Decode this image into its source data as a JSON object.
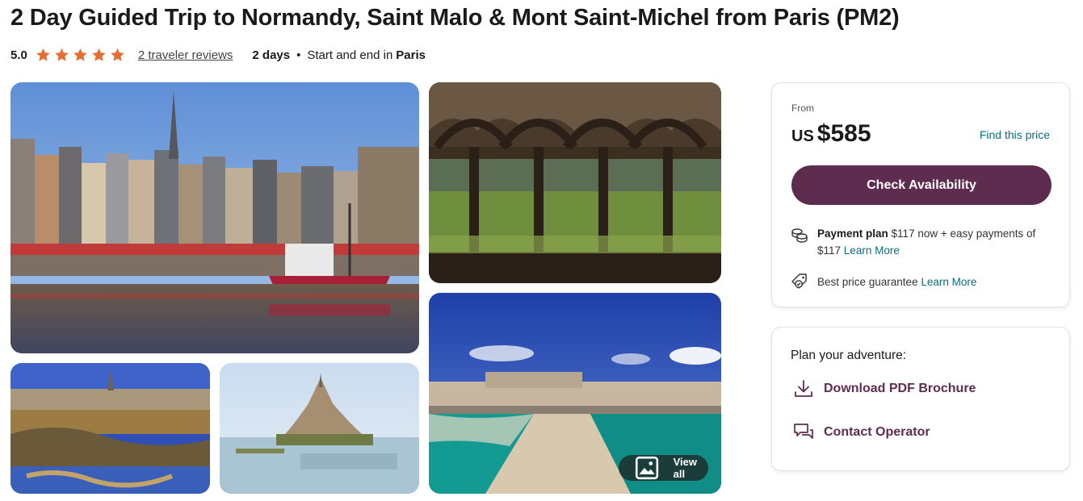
{
  "title": "2 Day Guided Trip to Normandy, Saint Malo & Mont Saint-Michel from Paris (PM2)",
  "meta": {
    "rating": "5.0",
    "stars": 5,
    "reviews_link": "2 traveler reviews",
    "duration": "2 days",
    "separator": "•",
    "start_end_prefix": "Start and end in",
    "city": "Paris"
  },
  "gallery": {
    "view_all_label": "View all"
  },
  "price_card": {
    "from_label": "From",
    "currency": "US",
    "amount": "$585",
    "find_price_link": "Find this price",
    "check_availability_label": "Check Availability",
    "payment_plan_label": "Payment plan",
    "payment_plan_text": "$117 now + easy payments of $117",
    "payment_learn_more": "Learn More",
    "guarantee_text": "Best price guarantee",
    "guarantee_learn_more": "Learn More"
  },
  "plan_card": {
    "title": "Plan your adventure:",
    "download_label": "Download PDF Brochure",
    "contact_label": "Contact Operator"
  },
  "colors": {
    "brand_purple": "#5e2c4f",
    "link_teal": "#0a6e82",
    "star_orange": "#e36f33"
  }
}
